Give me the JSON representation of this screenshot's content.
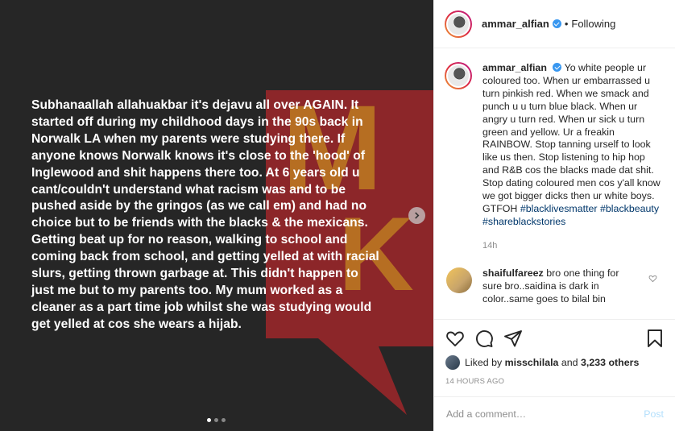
{
  "post": {
    "text_lines": [
      "Subhanaallah allahuakbar it's dejavu all over AGAIN.  It",
      "started off during my childhood days in the 90s back in",
      "Norwalk LA when my parents were studying there. If",
      "anyone knows Norwalk knows it's close to the 'hood' of",
      "Inglewood and shit happens there too. At 6 years old u",
      "cant/couldn't understand what racism was and to be",
      "pushed aside by the gringos (as we call em) and had no",
      "choice but to be friends with the blacks & the mexicans.",
      "Getting beat up for no reason, walking to school and",
      "coming back from school, and getting yelled at with racial",
      "slurs, getting thrown garbage at. This didn't happen to",
      "just me but to my parents too. My mum worked as a",
      "cleaner as a part time job whilst she was studying would",
      "get yelled at cos she wears a hijab."
    ],
    "carousel": {
      "count": 3,
      "active": 0
    },
    "watermark_letters": [
      "M",
      "K"
    ]
  },
  "header": {
    "username": "ammar_alfian",
    "separator": "•",
    "follow_status": "Following"
  },
  "caption": {
    "username": "ammar_alfian",
    "text": "Yo white people ur coloured too. When ur embarrassed u turn pinkish red. When we smack and punch u u turn blue black. When ur angry u turn red. When ur sick u turn green and yellow. Ur a freakin RAINBOW. Stop tanning urself to look like us then. Stop listening to hip hop and R&B cos the blacks made dat shit. Stop dating coloured men cos y'all know we got bigger dicks then ur white boys. GTFOH",
    "hashtags": [
      "#blacklivesmatter",
      "#blackbeauty",
      "#shareblackstories"
    ],
    "time": "14h"
  },
  "comment": {
    "username": "shaifulfareez",
    "text": "bro one thing for sure bro..saidina is dark in color..same goes to bilal bin"
  },
  "likes": {
    "prefix": "Liked by",
    "user": "misschilala",
    "connector": "and",
    "others": "3,233 others"
  },
  "timestamp": "14 HOURS AGO",
  "add_comment": {
    "placeholder": "Add a comment…",
    "post_label": "Post"
  },
  "colors": {
    "media_bg": "#262626",
    "watermark_red": "#e0262b",
    "watermark_yellow": "#e8c81a",
    "link": "#00376b",
    "post_disabled": "#b2dffc"
  }
}
